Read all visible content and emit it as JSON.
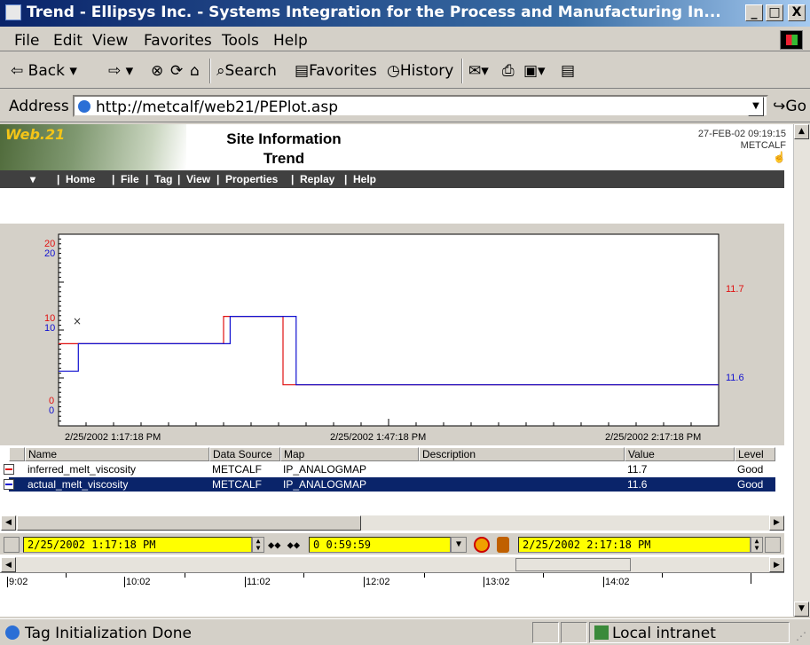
{
  "window": {
    "title": "Trend - Ellipsys Inc. - Systems Integration for the Process and Manufacturing In...",
    "min_label": "_",
    "max_label": "□",
    "close_label": "X"
  },
  "menu": [
    "File",
    "Edit",
    "View",
    "Favorites",
    "Tools",
    "Help"
  ],
  "toolbar": {
    "back_label": "Back",
    "search_label": "Search",
    "favorites_label": "Favorites",
    "history_label": "History"
  },
  "address": {
    "label": "Address",
    "url": "http://metcalf/web21/PEPlot.asp",
    "go_label": "Go"
  },
  "banner": {
    "logo": "Web.21",
    "title_line1": "Site Information",
    "title_line2": "Trend",
    "datetime": "27-FEB-02 09:19:15",
    "server": "METCALF"
  },
  "nav": [
    "Home",
    "File",
    "Tag",
    "View",
    "Properties",
    "Replay",
    "Help"
  ],
  "chart_data": {
    "type": "line",
    "x_tick_labels": [
      "2/25/2002  1:17:18 PM",
      "2/25/2002  1:47:18 PM",
      "2/25/2002  2:17:18 PM"
    ],
    "left_axis_red": [
      "20",
      "10",
      "0"
    ],
    "left_axis_blue": [
      "20",
      "10",
      "0"
    ],
    "right_labels": {
      "red": "11.7",
      "blue": "11.6"
    },
    "series": [
      {
        "name": "inferred_melt_viscosity",
        "color": "#e01010",
        "points": [
          [
            0,
            11.85
          ],
          [
            0.25,
            11.85
          ],
          [
            0.25,
            11.95
          ],
          [
            0.34,
            11.95
          ],
          [
            0.34,
            11.7
          ],
          [
            1,
            11.7
          ]
        ]
      },
      {
        "name": "actual_melt_viscosity",
        "color": "#1010d0",
        "points": [
          [
            0,
            11.75
          ],
          [
            0.03,
            11.75
          ],
          [
            0.03,
            11.85
          ],
          [
            0.26,
            11.85
          ],
          [
            0.26,
            11.95
          ],
          [
            0.36,
            11.95
          ],
          [
            0.36,
            11.7
          ],
          [
            1,
            11.7
          ]
        ]
      }
    ]
  },
  "table": {
    "headers": [
      "Name",
      "Data Source",
      "Map",
      "Description",
      "Value",
      "Level"
    ],
    "rows": [
      {
        "name": "inferred_melt_viscosity",
        "source": "METCALF",
        "map": "IP_ANALOGMAP",
        "description": "",
        "value": "11.7",
        "level": "Good",
        "color": "#e01010"
      },
      {
        "name": "actual_melt_viscosity",
        "source": "METCALF",
        "map": "IP_ANALOGMAP",
        "description": "",
        "value": "11.6",
        "level": "Good",
        "color": "#1010d0"
      }
    ]
  },
  "timebar": {
    "start": "2/25/2002  1:17:18 PM",
    "span": "0 0:59:59",
    "end": "2/25/2002  2:17:18 PM"
  },
  "timeline_labels": [
    "9:02",
    "10:02",
    "11:02",
    "12:02",
    "13:02",
    "14:02"
  ],
  "status": {
    "text": "Tag Initialization Done",
    "zone": "Local intranet"
  }
}
